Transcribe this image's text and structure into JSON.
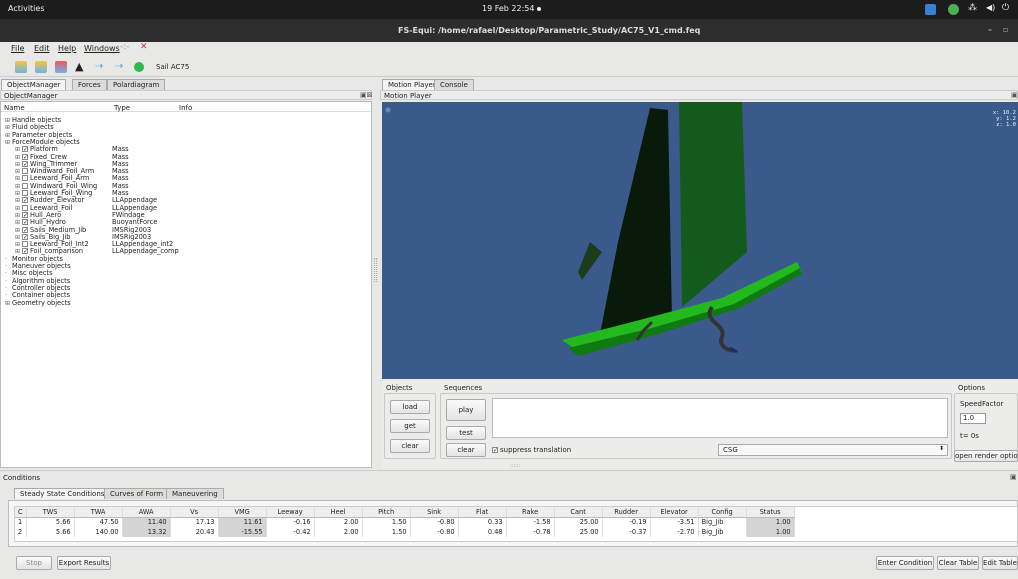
{
  "topbar": {
    "activities": "Activities",
    "clock": "19 Feb  22:54"
  },
  "window": {
    "title": "FS-Equi: /home/rafael/Desktop/Parametric_Study/AC75_V1_cmd.feq"
  },
  "menu": {
    "file": "File",
    "edit": "Edit",
    "help": "Help",
    "windows": "Windows"
  },
  "toolbar": {
    "sail_label": "Sail AC75"
  },
  "left_tabs": [
    "ObjectManager",
    "Forces",
    "Polardiagram"
  ],
  "right_tabs": [
    "Motion Player",
    "Console"
  ],
  "object_manager": {
    "title": "ObjectManager",
    "headers": {
      "name": "Name",
      "type": "Type",
      "info": "Info"
    },
    "tree": [
      {
        "name": "Handle objects",
        "type": "",
        "level": 0,
        "expand": true,
        "check": null
      },
      {
        "name": "Fluid objects",
        "type": "",
        "level": 0,
        "expand": true,
        "check": null
      },
      {
        "name": "Parameter objects",
        "type": "",
        "level": 0,
        "expand": true,
        "check": null
      },
      {
        "name": "ForceModule objects",
        "type": "",
        "level": 0,
        "expand": true,
        "check": null
      },
      {
        "name": "Platform",
        "type": "Mass",
        "level": 1,
        "expand": true,
        "check": true
      },
      {
        "name": "Fixed_Crew",
        "type": "Mass",
        "level": 1,
        "expand": true,
        "check": true
      },
      {
        "name": "Wing_Trimmer",
        "type": "Mass",
        "level": 1,
        "expand": true,
        "check": true
      },
      {
        "name": "Windward_Foil_Arm",
        "type": "Mass",
        "level": 1,
        "expand": true,
        "check": false
      },
      {
        "name": "Leeward_Foil_Arm",
        "type": "Mass",
        "level": 1,
        "expand": true,
        "check": false
      },
      {
        "name": "Windward_Foil_Wing",
        "type": "Mass",
        "level": 1,
        "expand": true,
        "check": false
      },
      {
        "name": "Leeward_Foil_Wing",
        "type": "Mass",
        "level": 1,
        "expand": true,
        "check": false
      },
      {
        "name": "Rudder_Elevator",
        "type": "LLAppendage",
        "level": 1,
        "expand": true,
        "check": true
      },
      {
        "name": "Leeward_Foil",
        "type": "LLAppendage",
        "level": 1,
        "expand": true,
        "check": false
      },
      {
        "name": "Hull_Aero",
        "type": "FWindage",
        "level": 1,
        "expand": true,
        "check": true
      },
      {
        "name": "Hull_Hydro",
        "type": "BuoyantForce",
        "level": 1,
        "expand": true,
        "check": true
      },
      {
        "name": "Sails_Medium_Jib",
        "type": "IMSRig2003",
        "level": 1,
        "expand": true,
        "check": true
      },
      {
        "name": "Sails_Big_Jib",
        "type": "IMSRig2003",
        "level": 1,
        "expand": true,
        "check": true
      },
      {
        "name": "Leeward_Foil_Int2",
        "type": "LLAppendage_int2",
        "level": 1,
        "expand": true,
        "check": false
      },
      {
        "name": "Foil_comparison",
        "type": "LLAppendage_comp",
        "level": 1,
        "expand": true,
        "check": true
      },
      {
        "name": "Monitor objects",
        "type": "",
        "level": 0,
        "expand": false,
        "check": null
      },
      {
        "name": "Maneuver objects",
        "type": "",
        "level": 0,
        "expand": false,
        "check": null
      },
      {
        "name": "Misc objects",
        "type": "",
        "level": 0,
        "expand": false,
        "check": null
      },
      {
        "name": "Algorithm objects",
        "type": "",
        "level": 0,
        "expand": false,
        "check": null
      },
      {
        "name": "Controller objects",
        "type": "",
        "level": 0,
        "expand": false,
        "check": null
      },
      {
        "name": "Container objects",
        "type": "",
        "level": 0,
        "expand": false,
        "check": null
      },
      {
        "name": "Geometry objects",
        "type": "",
        "level": 0,
        "expand": true,
        "check": null
      }
    ]
  },
  "motion_player": {
    "title": "Motion Player",
    "coords": [
      "x: 10.2",
      "y:  1.2",
      "z:  1.0"
    ],
    "objects_label": "Objects",
    "load": "load",
    "get": "get",
    "clear": "clear",
    "sequences_label": "Sequences",
    "play": "play",
    "test": "test",
    "seq_clear": "clear",
    "suppress": "suppress translation",
    "csg": "CSG",
    "options_label": "Options",
    "speed_label": "SpeedFactor",
    "speed_value": "1.0",
    "time": "t= 0s",
    "render_options": "open render options"
  },
  "conditions": {
    "title": "Conditions",
    "tabs": [
      "Steady State Conditions",
      "Curves of Form",
      "Maneuvering"
    ],
    "columns": [
      "C",
      "TWS",
      "TWA",
      "AWA",
      "Vs",
      "VMG",
      "Leeway",
      "Heel",
      "Pitch",
      "Sink",
      "Flat",
      "Rake",
      "Cant",
      "Rudder",
      "Elevator",
      "Config",
      "Status"
    ],
    "rows": [
      [
        "1",
        "5.66",
        "47.50",
        "11.40",
        "17.13",
        "11.61",
        "-0.16",
        "2.00",
        "1.50",
        "-0.80",
        "0.33",
        "-1.58",
        "25.00",
        "-0.19",
        "-3.51",
        "Big_Jib",
        "1.00"
      ],
      [
        "2",
        "5.66",
        "140.00",
        "13.32",
        "20.43",
        "-15.55",
        "-0.42",
        "2.00",
        "1.50",
        "-0.80",
        "0.48",
        "-0.78",
        "25.00",
        "-0.37",
        "-2.70",
        "Big_Jib",
        "1.00"
      ]
    ]
  },
  "bottom_buttons": {
    "stop": "Stop",
    "export": "Export Results",
    "enter": "Enter Condition",
    "clear_table": "Clear Table",
    "edit_table": "Edit Table"
  }
}
